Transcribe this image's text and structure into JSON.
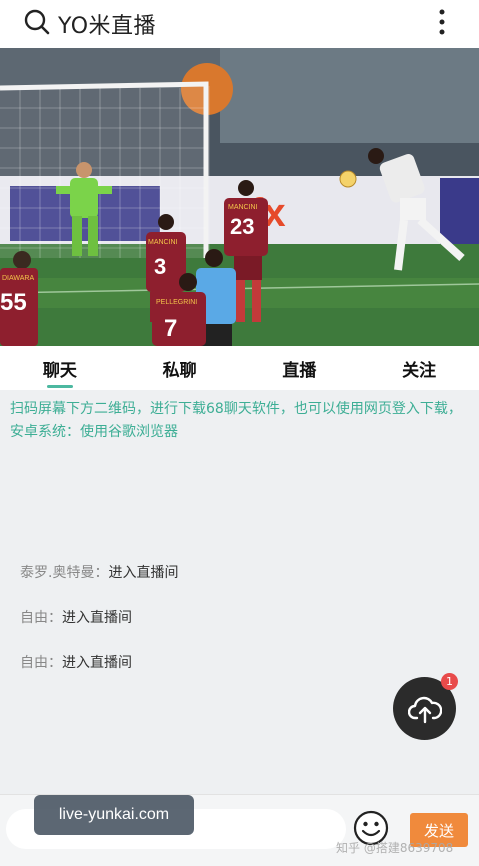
{
  "header": {
    "title": "YO米直播",
    "search_icon": "search-icon",
    "more_icon": "more-vertical-icon"
  },
  "video": {
    "shirt_numbers": [
      "55",
      "3",
      "23",
      "7"
    ],
    "shirt_names": [
      "DIAWARA",
      "MANCINI",
      "MANCINI",
      "PELLEGRINI"
    ],
    "ad_text": "fx"
  },
  "tabs": [
    {
      "label": "聊天",
      "active": true
    },
    {
      "label": "私聊",
      "active": false
    },
    {
      "label": "直播",
      "active": false
    },
    {
      "label": "关注",
      "active": false
    }
  ],
  "content": {
    "notice": "扫码屏幕下方二维码，进行下载68聊天软件，也可以使用网页登入下载，安卓系统：使用谷歌浏览器",
    "messages": [
      {
        "user": "泰罗.奥特曼",
        "sep": "：",
        "text": "进入直播间"
      },
      {
        "user": "自由",
        "sep": "：",
        "text": "进入直播间"
      },
      {
        "user": "自由",
        "sep": "：",
        "text": "进入直播间"
      }
    ],
    "upload_badge": "1"
  },
  "bottom": {
    "input_placeholder": "",
    "send_label": "发送",
    "watermark_url": "live-yunkai.com",
    "watermark_zhihu": "知乎 @搭建8639708"
  },
  "colors": {
    "accent": "#4cb8a0",
    "notice": "#3dae95",
    "send": "#f08a3c",
    "badge": "#e84b4b"
  }
}
